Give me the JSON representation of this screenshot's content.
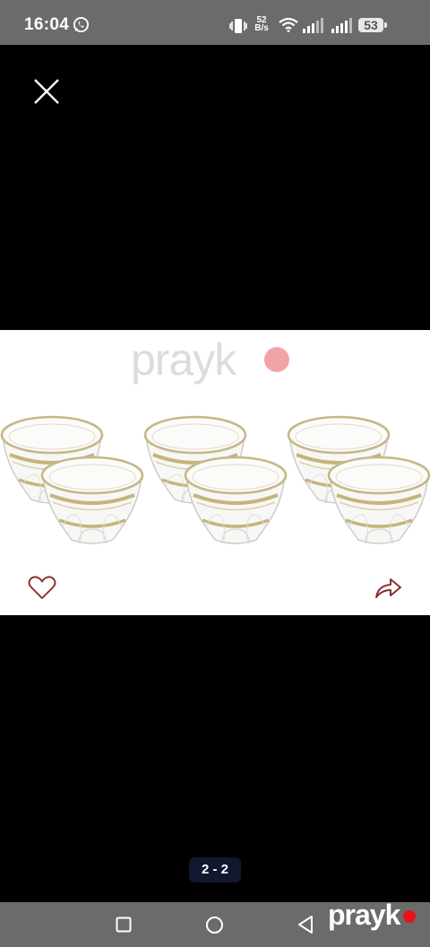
{
  "status_bar": {
    "time": "16:04",
    "network_speed_value": "52",
    "network_speed_unit": "B/s",
    "battery": "53",
    "icons": [
      "whatsapp-icon",
      "vibrate-icon",
      "wifi-icon",
      "signal-icon",
      "signal-icon",
      "battery-icon"
    ]
  },
  "viewer": {
    "close_icon": "close-icon",
    "watermark": "prayk",
    "like_icon": "heart-icon",
    "share_icon": "share-icon",
    "page_indicator": "2 - 2"
  },
  "nav_bar": {
    "icons": [
      "recent-apps-icon",
      "home-icon",
      "back-icon"
    ],
    "brand": "prayk"
  },
  "colors": {
    "status_bar_bg": "#6b6b6b",
    "viewer_bg": "#000000",
    "page_indicator_bg": "#101830",
    "brand_dot": "#e8121d",
    "watermark_dot": "#f1a4a7"
  }
}
